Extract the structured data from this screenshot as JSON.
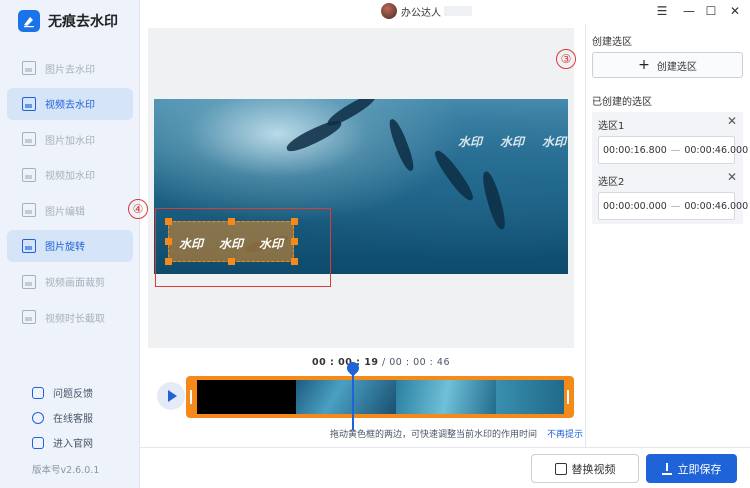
{
  "app": {
    "title": "无痕去水印"
  },
  "sidebar": {
    "items": [
      {
        "label": "图片去水印",
        "active": false
      },
      {
        "label": "视频去水印",
        "active": true
      },
      {
        "label": "图片加水印",
        "active": false
      },
      {
        "label": "视频加水印",
        "active": false
      },
      {
        "label": "图片编辑",
        "active": false
      },
      {
        "label": "图片旋转",
        "active": true
      },
      {
        "label": "视频画面裁剪",
        "active": false
      },
      {
        "label": "视频时长截取",
        "active": false
      }
    ],
    "links": [
      {
        "label": "问题反馈",
        "icon": "feedback-icon"
      },
      {
        "label": "在线客服",
        "icon": "service-icon"
      },
      {
        "label": "进入官网",
        "icon": "website-icon"
      }
    ],
    "version": "版本号v2.6.0.1"
  },
  "topbar": {
    "user_name": "办公达人",
    "menu_icon": "☰",
    "minimize_icon": "—",
    "maximize_icon": "☐",
    "close_icon": "✕"
  },
  "preview": {
    "watermark_text": "水印",
    "annotation_left": "④",
    "annotation_right": "③"
  },
  "timeline": {
    "current_time": "00 : 00 : 19",
    "separator": " / ",
    "total_time": "00 : 00 : 46",
    "hint": "拖动黄色框的两边，可快速调整当前水印的作用时间",
    "hint_link": "不再提示"
  },
  "right_panel": {
    "create_title": "创建选区",
    "create_button": "创建选区",
    "created_title": "已创建的选区",
    "regions": [
      {
        "name": "选区1",
        "start": "00:00:16.800",
        "end": "00:00:46.000"
      },
      {
        "name": "选区2",
        "start": "00:00:00.000",
        "end": "00:00:46.000"
      }
    ],
    "range_sep": "—",
    "close_icon": "✕"
  },
  "bottom": {
    "replace_button": "替换视频",
    "save_button": "立即保存"
  },
  "colors": {
    "accent": "#1e63d8",
    "orange": "#f58a1a",
    "annotation_red": "#d93a3a"
  }
}
